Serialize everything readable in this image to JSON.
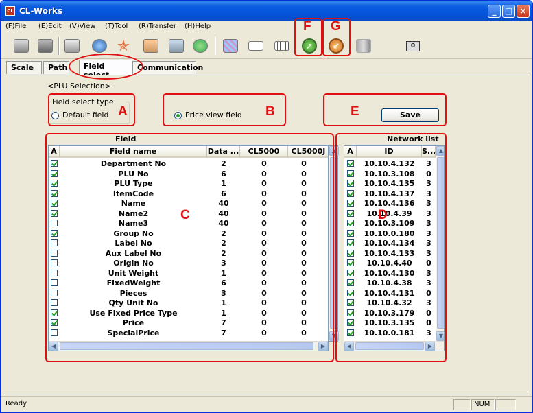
{
  "window": {
    "title": "CL-Works",
    "app_icon_text": "CL"
  },
  "menu": [
    {
      "label": "(F)File"
    },
    {
      "label": "(E)Edit"
    },
    {
      "label": "(V)View"
    },
    {
      "label": "(T)Tool"
    },
    {
      "label": "(R)Transfer"
    },
    {
      "label": "(H)Help"
    }
  ],
  "toolbar": {
    "counter": "0"
  },
  "tabs": [
    {
      "label": "Scale"
    },
    {
      "label": "Path"
    },
    {
      "label": "Field select"
    },
    {
      "label": "Communication"
    }
  ],
  "section_title": "<PLU Selection>",
  "field_select": {
    "group_label": "Field select type",
    "default_label": "Default field",
    "price_view_label": "Price view field",
    "selected": "price_view"
  },
  "save_label": "Save",
  "annotations": {
    "A": "A",
    "B": "B",
    "C": "C",
    "D": "D",
    "E": "E",
    "F": "F",
    "G": "G"
  },
  "field_panel": {
    "title": "Field",
    "columns": [
      "A",
      "Field name",
      "Data ...",
      "CL5000",
      "CL5000J"
    ],
    "rows": [
      {
        "checked": true,
        "name": "Department No",
        "data": "2",
        "cl5000": "0",
        "cl5000j": "0"
      },
      {
        "checked": true,
        "name": "PLU No",
        "data": "6",
        "cl5000": "0",
        "cl5000j": "0"
      },
      {
        "checked": true,
        "name": "PLU Type",
        "data": "1",
        "cl5000": "0",
        "cl5000j": "0"
      },
      {
        "checked": true,
        "name": "ItemCode",
        "data": "6",
        "cl5000": "0",
        "cl5000j": "0"
      },
      {
        "checked": true,
        "name": "Name",
        "data": "40",
        "cl5000": "0",
        "cl5000j": "0"
      },
      {
        "checked": true,
        "name": "Name2",
        "data": "40",
        "cl5000": "0",
        "cl5000j": "0"
      },
      {
        "checked": false,
        "name": "Name3",
        "data": "40",
        "cl5000": "0",
        "cl5000j": "0"
      },
      {
        "checked": true,
        "name": "Group No",
        "data": "2",
        "cl5000": "0",
        "cl5000j": "0"
      },
      {
        "checked": false,
        "name": "Label No",
        "data": "2",
        "cl5000": "0",
        "cl5000j": "0"
      },
      {
        "checked": false,
        "name": "Aux Label No",
        "data": "2",
        "cl5000": "0",
        "cl5000j": "0"
      },
      {
        "checked": false,
        "name": "Origin No",
        "data": "3",
        "cl5000": "0",
        "cl5000j": "0"
      },
      {
        "checked": false,
        "name": "Unit Weight",
        "data": "1",
        "cl5000": "0",
        "cl5000j": "0"
      },
      {
        "checked": false,
        "name": "FixedWeight",
        "data": "6",
        "cl5000": "0",
        "cl5000j": "0"
      },
      {
        "checked": false,
        "name": "Pieces",
        "data": "3",
        "cl5000": "0",
        "cl5000j": "0"
      },
      {
        "checked": false,
        "name": "Qty Unit No",
        "data": "1",
        "cl5000": "0",
        "cl5000j": "0"
      },
      {
        "checked": true,
        "name": "Use Fixed Price Type",
        "data": "1",
        "cl5000": "0",
        "cl5000j": "0"
      },
      {
        "checked": true,
        "name": "Price",
        "data": "7",
        "cl5000": "0",
        "cl5000j": "0"
      },
      {
        "checked": false,
        "name": "SpecialPrice",
        "data": "7",
        "cl5000": "0",
        "cl5000j": "0"
      }
    ]
  },
  "network_panel": {
    "title": "Network list",
    "columns": [
      "A",
      "ID",
      "S..."
    ],
    "rows": [
      {
        "checked": true,
        "id": "10.10.4.132",
        "s": "3"
      },
      {
        "checked": true,
        "id": "10.10.3.108",
        "s": "0"
      },
      {
        "checked": true,
        "id": "10.10.4.135",
        "s": "3"
      },
      {
        "checked": true,
        "id": "10.10.4.137",
        "s": "3"
      },
      {
        "checked": true,
        "id": "10.10.4.136",
        "s": "3"
      },
      {
        "checked": true,
        "id": "10.10.4.39",
        "s": "3"
      },
      {
        "checked": true,
        "id": "10.10.3.109",
        "s": "3"
      },
      {
        "checked": true,
        "id": "10.10.0.180",
        "s": "3"
      },
      {
        "checked": true,
        "id": "10.10.4.134",
        "s": "3"
      },
      {
        "checked": true,
        "id": "10.10.4.133",
        "s": "3"
      },
      {
        "checked": true,
        "id": "10.10.4.40",
        "s": "0"
      },
      {
        "checked": true,
        "id": "10.10.4.130",
        "s": "3"
      },
      {
        "checked": true,
        "id": "10.10.4.38",
        "s": "3"
      },
      {
        "checked": true,
        "id": "10.10.4.131",
        "s": "0"
      },
      {
        "checked": true,
        "id": "10.10.4.32",
        "s": "3"
      },
      {
        "checked": true,
        "id": "10.10.3.179",
        "s": "0"
      },
      {
        "checked": true,
        "id": "10.10.3.135",
        "s": "0"
      },
      {
        "checked": true,
        "id": "10.10.0.181",
        "s": "3"
      }
    ]
  },
  "status": {
    "text": "Ready",
    "num": "NUM"
  },
  "colors": {
    "annotation": "#e01010",
    "titlebar": "#0a5ce0",
    "check": "#21a121"
  }
}
